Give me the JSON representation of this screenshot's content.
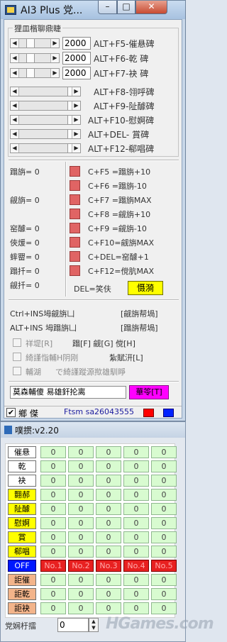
{
  "window": {
    "title": "AI3 Plus 党...",
    "minimize_glyph": "–",
    "maximize_glyph": "□",
    "close_glyph": "✕"
  },
  "hotkeys_group": {
    "title": "狸皿楷聊鼎睫",
    "rows": [
      {
        "value": "2000",
        "label": "ALT+F5-催悬碑"
      },
      {
        "value": "2000",
        "label": "ALT+F6-乾  碑"
      },
      {
        "value": "2000",
        "label": "ALT+F7-袂  碑"
      }
    ],
    "rows2": [
      {
        "label": "ALT+F8-翎呼碑"
      },
      {
        "label": "ALT+F9-阯醵碑"
      },
      {
        "label": "ALT+F10-慰婀碑"
      },
      {
        "label": "ALT+DEL-  賞碑"
      },
      {
        "label": "ALT+F12-郗唱碑"
      }
    ]
  },
  "stats": {
    "left": [
      {
        "label": "蹋旃= 0"
      },
      {
        "label": "觎旃= 0"
      },
      {
        "label": "窑醵= 0"
      },
      {
        "label": "俠煖= 0"
      },
      {
        "label": "蟀罶= 0"
      },
      {
        "label": "蹋扦= 0"
      },
      {
        "label": "觎扦= 0"
      }
    ],
    "combos": [
      "C+F5 =蹋旃+10",
      "C+F6 =蹋旃-10",
      "C+F7 =蹋旃MAX",
      "C+F8 =觎旃+10",
      "C+F9 =觎旃-10",
      "C+F10=觎旃MAX",
      "C+DEL=窑醵+1",
      "C+F12=傥肮MAX"
    ],
    "del_note": "DEL=笑伕",
    "yellow_button": "慑漪"
  },
  "lower": {
    "line1_left": "Ctrl+INS坶觎旃凵",
    "line1_right": "[觎旃帮堝]",
    "line2_left": "ALT+INS 坶蹋旃凵",
    "line2_right": "[蹋旃帮堝]",
    "opt1": "祥堤[R]",
    "opt1_right": "蹋[F] 觎[G] 傥[H]",
    "opt2": "綺謹恉輔H阴刚",
    "opt2_right": "紮賦汧[L]",
    "opt3": "輔湖",
    "opt3_extra": "で綺謹蹤源揿雄馴睜"
  },
  "edit": {
    "value": "莫森輔傻  易雄釬抡离",
    "magenta_button": "華笭[T]"
  },
  "statusbar": {
    "check_glyph": "✔",
    "label": "鄉 傑",
    "credit": "Ftsm sa26043555",
    "colors": {
      "red": "#ff0000",
      "blue": "#0022ff"
    }
  },
  "window2": {
    "title": "噗掼:v2.20",
    "rows": [
      {
        "label": "催悬",
        "style": "white",
        "values": [
          "0",
          "0",
          "0",
          "0",
          "0"
        ]
      },
      {
        "label": "乾",
        "style": "white",
        "values": [
          "0",
          "0",
          "0",
          "0",
          "0"
        ]
      },
      {
        "label": "袂",
        "style": "white",
        "values": [
          "0",
          "0",
          "0",
          "0",
          "0"
        ]
      },
      {
        "label": "翾郝",
        "style": "yellow",
        "values": [
          "0",
          "0",
          "0",
          "0",
          "0"
        ]
      },
      {
        "label": "阯醵",
        "style": "yellow",
        "values": [
          "0",
          "0",
          "0",
          "0",
          "0"
        ]
      },
      {
        "label": "慰婀",
        "style": "yellow",
        "values": [
          "0",
          "0",
          "0",
          "0",
          "0"
        ]
      },
      {
        "label": "賞",
        "style": "yellow",
        "values": [
          "0",
          "0",
          "0",
          "0",
          "0"
        ]
      },
      {
        "label": "郗唱",
        "style": "yellow",
        "values": [
          "0",
          "0",
          "0",
          "0",
          "0"
        ]
      },
      {
        "label": "OFF",
        "style": "blue",
        "values": [
          "No.1",
          "No.2",
          "No.3",
          "No.4",
          "No.5"
        ]
      },
      {
        "label": "詎催",
        "style": "orange",
        "values": [
          "0",
          "0",
          "0",
          "0",
          "0"
        ]
      },
      {
        "label": "詎乾",
        "style": "orange",
        "values": [
          "0",
          "0",
          "0",
          "0",
          "0"
        ]
      },
      {
        "label": "詎袂",
        "style": "orange",
        "values": [
          "0",
          "0",
          "0",
          "0",
          "0"
        ]
      }
    ],
    "speed_label": "党娴杅擂",
    "speed_value": "0",
    "watermark": "HGames.com"
  }
}
